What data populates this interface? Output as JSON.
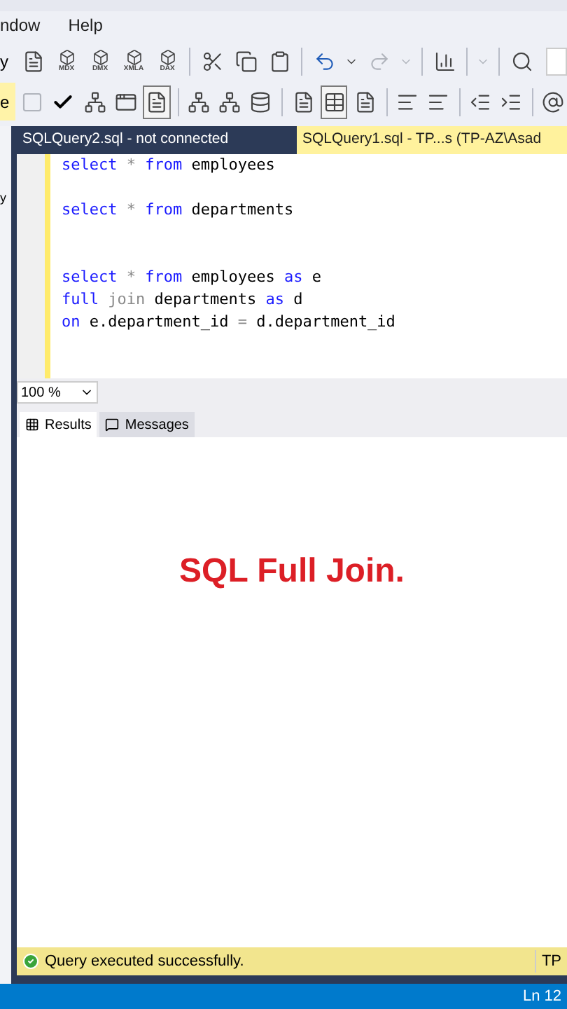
{
  "menu": [
    "ndow",
    "Help"
  ],
  "toolbar_1": {
    "cut_label": "y",
    "icons": [
      {
        "kind": "doc"
      },
      {
        "kind": "cube",
        "label": "MDX"
      },
      {
        "kind": "cube",
        "label": "DMX"
      },
      {
        "kind": "cube",
        "label": "XMLA"
      },
      {
        "kind": "cube",
        "label": "DAX"
      },
      {
        "kind": "sep"
      },
      {
        "kind": "cut"
      },
      {
        "kind": "copy"
      },
      {
        "kind": "paste"
      },
      {
        "kind": "sep"
      },
      {
        "kind": "undo"
      },
      {
        "kind": "caret"
      },
      {
        "kind": "redo",
        "disabled": true
      },
      {
        "kind": "caret",
        "disabled": true
      },
      {
        "kind": "sep"
      },
      {
        "kind": "chart"
      },
      {
        "kind": "sep"
      },
      {
        "kind": "caret",
        "disabled": true
      },
      {
        "kind": "sep"
      },
      {
        "kind": "find"
      }
    ]
  },
  "toolbar_2": {
    "cut_label": "e",
    "icons": [
      {
        "kind": "stop",
        "disabled": true
      },
      {
        "kind": "check"
      },
      {
        "kind": "tree"
      },
      {
        "kind": "window"
      },
      {
        "kind": "doc",
        "selected": true
      },
      {
        "kind": "sep"
      },
      {
        "kind": "tree"
      },
      {
        "kind": "tree"
      },
      {
        "kind": "db"
      },
      {
        "kind": "sep"
      },
      {
        "kind": "doc"
      },
      {
        "kind": "grid",
        "selected": true
      },
      {
        "kind": "doc"
      },
      {
        "kind": "sep"
      },
      {
        "kind": "lines"
      },
      {
        "kind": "lines"
      },
      {
        "kind": "sep"
      },
      {
        "kind": "outdent"
      },
      {
        "kind": "indent"
      },
      {
        "kind": "sep"
      },
      {
        "kind": "at"
      }
    ]
  },
  "side_panel": {
    "label": "y"
  },
  "tabs": [
    {
      "label": "SQLQuery2.sql - not connected",
      "selected": false
    },
    {
      "label": "SQLQuery1.sql - TP...s (TP-AZ\\Asad",
      "selected": true
    }
  ],
  "editor": {
    "lines": [
      [
        {
          "kind": "kw",
          "text": "select"
        },
        {
          "kind": "op",
          "text": " * "
        },
        {
          "kind": "kw",
          "text": "from"
        },
        {
          "kind": "id",
          "text": " employees"
        }
      ],
      [
        {
          "kind": "blank"
        }
      ],
      [
        {
          "kind": "kw",
          "text": "select"
        },
        {
          "kind": "op",
          "text": " * "
        },
        {
          "kind": "kw",
          "text": "from"
        },
        {
          "kind": "id",
          "text": " departments"
        }
      ],
      [
        {
          "kind": "blank"
        }
      ],
      [
        {
          "kind": "blank"
        }
      ],
      [
        {
          "kind": "kw",
          "text": "select"
        },
        {
          "kind": "op",
          "text": " * "
        },
        {
          "kind": "kw",
          "text": "from"
        },
        {
          "kind": "id",
          "text": " employees "
        },
        {
          "kind": "kw",
          "text": "as"
        },
        {
          "kind": "id",
          "text": " e"
        }
      ],
      [
        {
          "kind": "kw",
          "text": "full"
        },
        {
          "kind": "op",
          "text": " join"
        },
        {
          "kind": "id",
          "text": " departments "
        },
        {
          "kind": "kw",
          "text": "as"
        },
        {
          "kind": "id",
          "text": " d"
        }
      ],
      [
        {
          "kind": "kw",
          "text": "on"
        },
        {
          "kind": "id",
          "text": " e.department_id "
        },
        {
          "kind": "op",
          "text": "="
        },
        {
          "kind": "id",
          "text": " d.department_id"
        }
      ]
    ]
  },
  "zoom": "100 %",
  "result_tabs": [
    {
      "label": "Results",
      "selected": true
    },
    {
      "label": "Messages",
      "selected": false
    }
  ],
  "overlay_title": "SQL Full Join.",
  "status": {
    "message": "Query executed successfully.",
    "server": "TP"
  },
  "status_bar": {
    "position": "Ln 12"
  }
}
